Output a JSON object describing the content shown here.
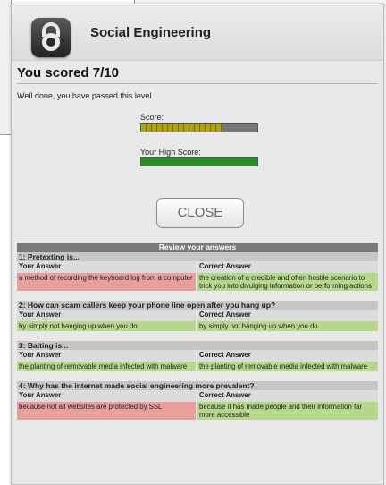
{
  "header": {
    "title": "Social Engineering",
    "icon": "padlock-icon"
  },
  "result": {
    "headline": "You scored 7/10",
    "message": "Well done, you have passed this level",
    "score_label": "Score:",
    "score_fraction": 0.7,
    "high_score_label": "Your High Score:",
    "high_score_fraction": 1.0
  },
  "close_label": "CLOSE",
  "review": {
    "title": "Review your answers",
    "your_answer_header": "Your Answer",
    "correct_answer_header": "Correct Answer",
    "questions": [
      {
        "question": "1: Pretexting is...",
        "your_answer": "a method of recording the keyboard log from a computer",
        "correct_answer": "the creation of a credible and often hostile scenario to trick you into divulging information or performing actions",
        "your_correct": false
      },
      {
        "question": "2: How can scam callers keep your phone line open after you hang up?",
        "your_answer": "by simply not hanging up when you do",
        "correct_answer": "by simply not hanging up when you do",
        "your_correct": true
      },
      {
        "question": "3: Baiting is...",
        "your_answer": "the planting of removable media infected with malware",
        "correct_answer": "the planting of removable media infected with malware",
        "your_correct": true
      },
      {
        "question": "4: Why has the internet made social engineering more prevalent?",
        "your_answer": "because not all websites are protected by SSL",
        "correct_answer": "because it has made people and their information far more accessible",
        "your_correct": false
      }
    ]
  },
  "colors": {
    "wrong": "#e8a09c",
    "right": "#b6d78c",
    "score_bar": "#b4a400",
    "high_score_bar": "#1a9a1a"
  }
}
